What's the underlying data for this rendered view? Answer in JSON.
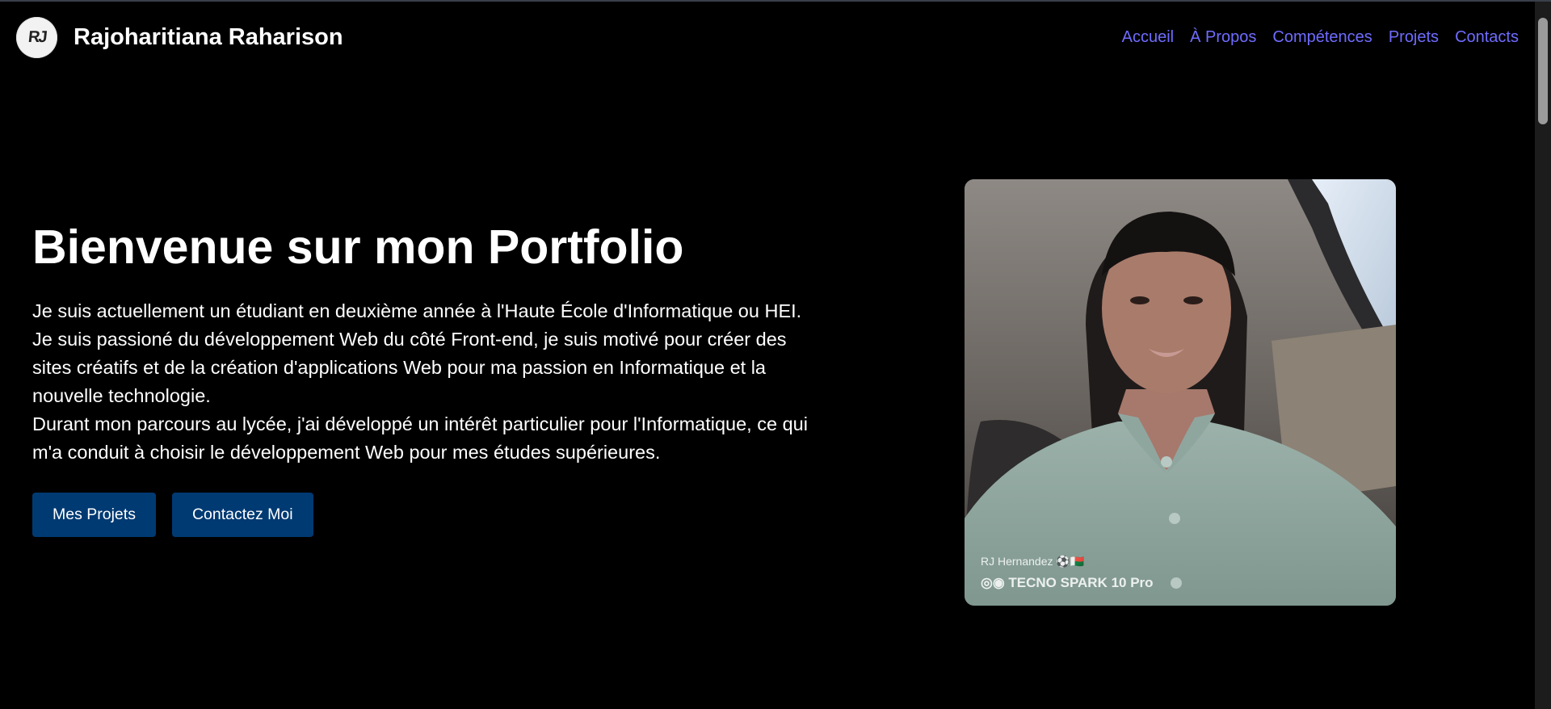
{
  "header": {
    "logo_text": "RJ",
    "brand_name": "Rajoharitiana Raharison",
    "nav": [
      {
        "label": "Accueil"
      },
      {
        "label": "À Propos"
      },
      {
        "label": "Compétences"
      },
      {
        "label": "Projets"
      },
      {
        "label": "Contacts"
      }
    ]
  },
  "hero": {
    "title": "Bienvenue sur mon Portfolio",
    "paragraphs": [
      "Je suis actuellement un étudiant en deuxième année à l'Haute École d'Informatique ou HEI.",
      "Je suis passioné du développement Web du côté Front-end, je suis motivé pour créer des sites créatifs et de la création d'applications Web pour ma passion en Informatique et la nouvelle technologie.",
      "Durant mon parcours au lycée, j'ai développé un intérêt particulier pour l'Informatique, ce qui m'a conduit à choisir le développement Web pour mes études supérieures."
    ],
    "buttons": {
      "projects": "Mes Projets",
      "contact": "Contactez Moi"
    }
  },
  "photo": {
    "watermark_line1": "RJ Hernandez ⚽🇲🇬",
    "watermark_line2": "◎◉ TECNO SPARK 10 Pro"
  },
  "colors": {
    "background": "#000000",
    "nav_link": "#6f6cff",
    "button_bg": "#003a73"
  }
}
